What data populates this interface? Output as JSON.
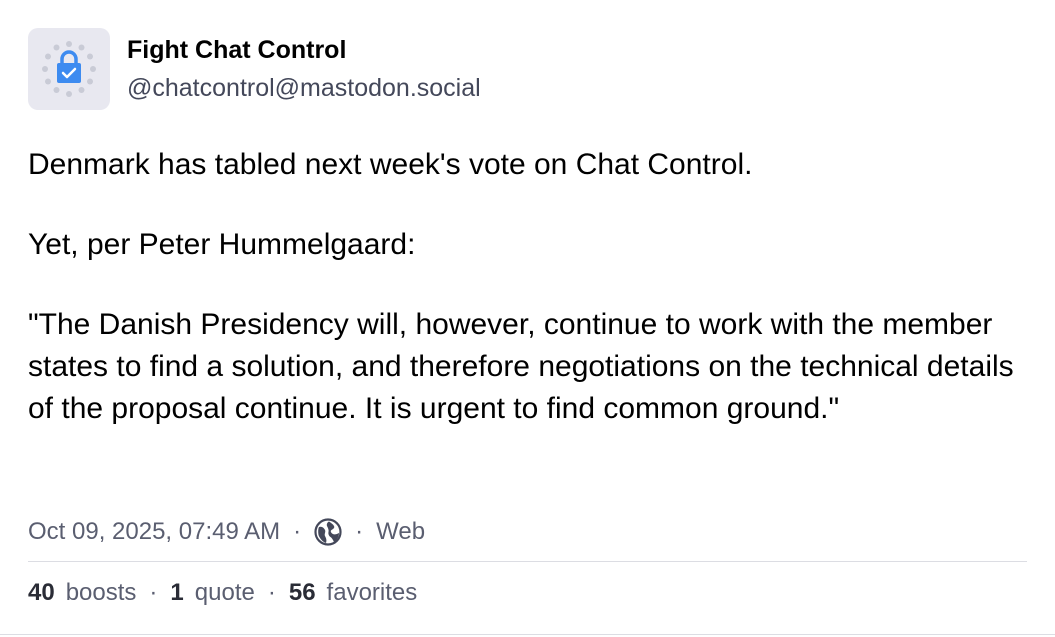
{
  "account": {
    "display_name": "Fight Chat Control",
    "handle": "@chatcontrol@mastodon.social",
    "avatar_icon": "padlock-eu-stars-icon"
  },
  "post": {
    "paragraphs": [
      "Denmark has tabled next week's vote on Chat Control.",
      "Yet, per Peter Hummelgaard:",
      "\"The Danish Presidency will, however, continue to work with the member states to find a solution, and therefore negotiations on the technical details of the proposal continue. It is urgent to find common ground.\""
    ]
  },
  "meta": {
    "timestamp": "Oct 09, 2025, 07:49 AM",
    "separator": "·",
    "visibility_icon": "globe-icon",
    "client": "Web"
  },
  "stats": {
    "boosts_count": "40",
    "boosts_label": "boosts",
    "quote_count": "1",
    "quote_label": "quote",
    "favorites_count": "56",
    "favorites_label": "favorites"
  },
  "colors": {
    "avatar_bg": "#e8e8f0",
    "lock_blue": "#3d8bf0",
    "muted_text": "#5a5e70"
  }
}
